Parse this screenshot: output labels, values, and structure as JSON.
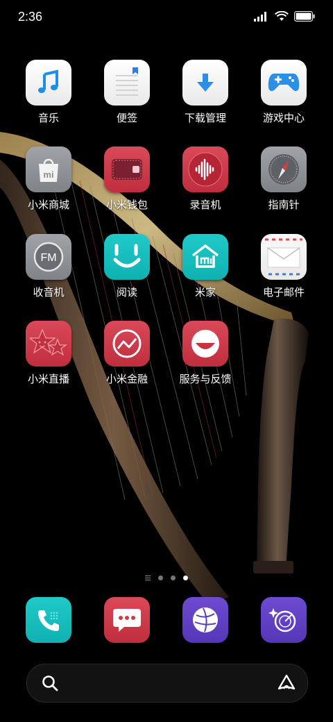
{
  "status_bar": {
    "time": "2:36"
  },
  "apps": [
    {
      "label": "音乐",
      "icon": "music-note-icon"
    },
    {
      "label": "便签",
      "icon": "notes-icon"
    },
    {
      "label": "下载管理",
      "icon": "download-icon"
    },
    {
      "label": "游戏中心",
      "icon": "gamepad-icon"
    },
    {
      "label": "小米商城",
      "icon": "shopping-bag-icon"
    },
    {
      "label": "小米钱包",
      "icon": "wallet-icon"
    },
    {
      "label": "录音机",
      "icon": "waveform-icon"
    },
    {
      "label": "指南针",
      "icon": "compass-icon"
    },
    {
      "label": "收音机",
      "icon": "fm-radio-icon"
    },
    {
      "label": "阅读",
      "icon": "reading-smile-icon"
    },
    {
      "label": "米家",
      "icon": "mi-home-icon"
    },
    {
      "label": "电子邮件",
      "icon": "envelope-icon"
    },
    {
      "label": "小米直播",
      "icon": "stars-face-icon"
    },
    {
      "label": "小米金融",
      "icon": "finance-chart-icon"
    },
    {
      "label": "服务与反馈",
      "icon": "smile-feedback-icon"
    }
  ],
  "page_indicator": {
    "total_dots": 3,
    "active_index": 2
  },
  "dock": [
    {
      "icon": "phone-icon"
    },
    {
      "icon": "message-bubble-icon"
    },
    {
      "icon": "browser-globe-icon"
    },
    {
      "icon": "security-scan-icon"
    }
  ],
  "colors": {
    "teal": "#17bebe",
    "red": "#cf3b4b",
    "purple": "#6040c4",
    "grey": "#8e9196"
  }
}
